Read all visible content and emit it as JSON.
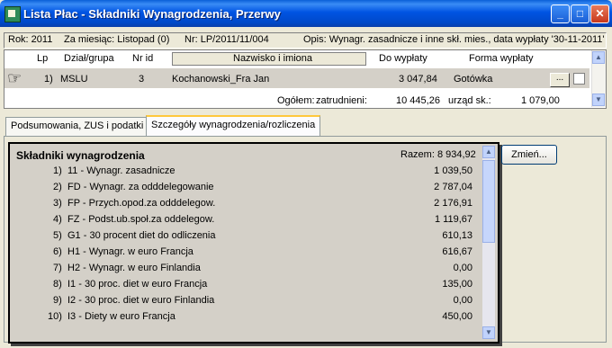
{
  "window": {
    "title": "Lista Płac - Składniki Wynagrodzenia, Przerwy"
  },
  "info": {
    "rok": "Rok: 2011",
    "miesiac": "Za miesiąc: Listopad (0)",
    "nr": "Nr: LP/2011/11/004",
    "opis": "Opis:  Wynagr. zasadnicze i inne skł. mies., data wypłaty '30-11-2011'"
  },
  "grid": {
    "headers": {
      "lp": "Lp",
      "dzial": "Dział/grupa",
      "nr_id": "Nr id",
      "nazwisko": "Nazwisko i imiona",
      "do_wyplaty": "Do wypłaty",
      "forma": "Forma wypłaty"
    },
    "row": {
      "lp": "1)",
      "dzial": "MSLU",
      "nr_id": "3",
      "nazwisko": "Kochanowski_Fra Jan",
      "do_wyplaty": "3 047,84",
      "forma": "Gotówka",
      "more_btn": "..."
    },
    "totals": {
      "ogolem": "Ogółem:",
      "zatrudnieni_label": "zatrudnieni:",
      "zatrudnieni_value": "10 445,26",
      "urzad_label": "urząd sk.:",
      "urzad_value": "1 079,00"
    }
  },
  "tabs": [
    "Podsumowania, ZUS i podatki",
    "Szczegóły wynagrodzenia/rozliczenia"
  ],
  "components": {
    "title": "Składniki wynagrodzenia",
    "total": "Razem: 8 934,92",
    "rows": [
      {
        "num": "1)",
        "name": "11 - Wynagr. zasadnicze",
        "value": "1 039,50"
      },
      {
        "num": "2)",
        "name": "FD - Wynagr. za odddelegowanie",
        "value": "2 787,04"
      },
      {
        "num": "3)",
        "name": "FP - Przych.opod.za odddelegow.",
        "value": "2 176,91"
      },
      {
        "num": "4)",
        "name": "FZ - Podst.ub.społ.za oddelegow.",
        "value": "1 119,67"
      },
      {
        "num": "5)",
        "name": "G1 - 30 procent diet do odliczenia",
        "value": "610,13"
      },
      {
        "num": "6)",
        "name": "H1 - Wynagr. w euro Francja",
        "value": "616,67"
      },
      {
        "num": "7)",
        "name": "H2 - Wynagr. w euro Finlandia",
        "value": "0,00"
      },
      {
        "num": "8)",
        "name": "I1 - 30 proc. diet w euro Francja",
        "value": "135,00"
      },
      {
        "num": "9)",
        "name": "I2 - 30 proc. diet w euro Finlandia",
        "value": "0,00"
      },
      {
        "num": "10)",
        "name": "I3 - Diety w euro Francja",
        "value": "450,00"
      }
    ],
    "change_button": "Zmień..."
  },
  "colors": {
    "titlebar": "#0054e3",
    "face": "#ece9d8",
    "tab_highlight": "#ffc83c"
  }
}
